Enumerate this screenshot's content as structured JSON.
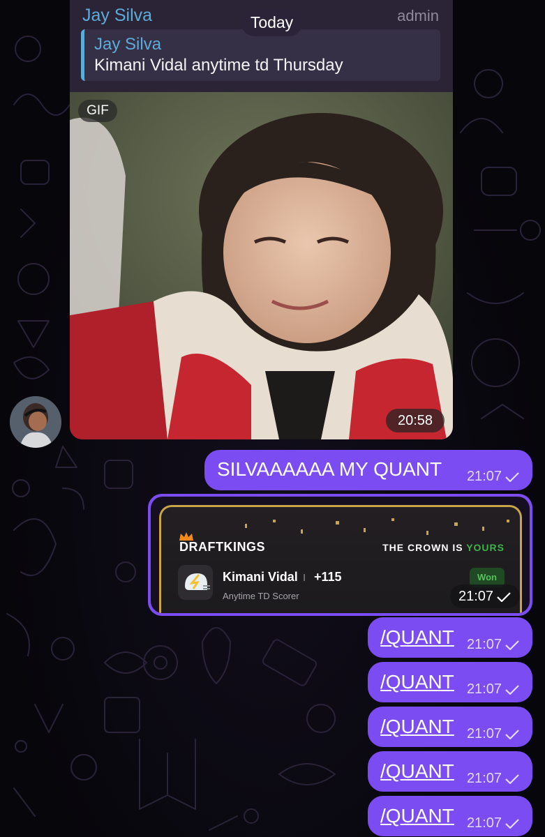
{
  "date_separator": "Today",
  "incoming": {
    "sender": "Jay Silva",
    "role": "admin",
    "reply": {
      "name": "Jay Silva",
      "text": "Kimani Vidal anytime td Thursday"
    },
    "media_badge": "GIF",
    "time": "20:58"
  },
  "outgoing": {
    "first": {
      "text": "SILVAAAAAA MY QUANT",
      "time": "21:07"
    },
    "bet_card": {
      "brand": "DRAFTKINGS",
      "tagline_prefix": "THE CROWN IS",
      "tagline_emph": "YOURS",
      "player": "Kimani Vidal",
      "separator": "I",
      "odds": "+115",
      "market": "Anytime TD Scorer",
      "status": "Won",
      "time": "21:07"
    },
    "commands": [
      {
        "text": "/QUANT",
        "time": "21:07"
      },
      {
        "text": "/QUANT",
        "time": "21:07"
      },
      {
        "text": "/QUANT",
        "time": "21:07"
      },
      {
        "text": "/QUANT",
        "time": "21:07"
      },
      {
        "text": "/QUANT",
        "time": "21:07"
      }
    ]
  },
  "colors": {
    "outgoing_bubble": "#7b4cf1",
    "incoming_bubble": "#2a2436",
    "sender_name": "#5dabd9",
    "draftkings_green": "#3cb34a",
    "won_green": "#55c25b",
    "card_border_gold": "#c9a54a"
  },
  "icons": {
    "read_receipt": "check-icon",
    "avatar": "user-avatar",
    "helmet": "chargers-helmet-icon"
  }
}
